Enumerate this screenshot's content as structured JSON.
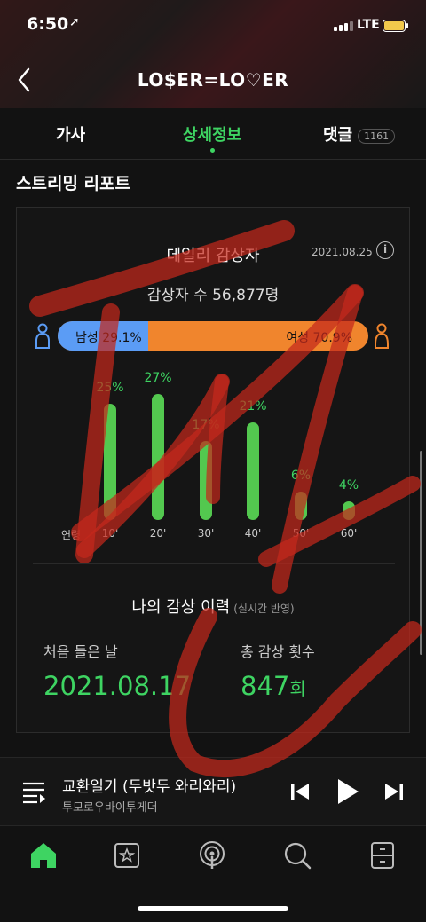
{
  "status_bar": {
    "time": "6:50",
    "network": "LTE"
  },
  "nav": {
    "title": "LO$ER=LO♡ER"
  },
  "tabs": [
    {
      "label": "가사"
    },
    {
      "label": "상세정보",
      "active": true
    },
    {
      "label": "댓글",
      "badge": "1161"
    }
  ],
  "section": {
    "title": "스트리밍 리포트"
  },
  "daily": {
    "title": "데일리 감상자",
    "date": "2021.08.25",
    "listeners": "감상자 수 56,877명",
    "gender": {
      "male_label": "남성 29.1%",
      "female_label": "여성 70.9%",
      "male_fraction": 0.291
    }
  },
  "age_chart": {
    "axis_label": "연령",
    "labels": [
      "10'",
      "20'",
      "30'",
      "40'",
      "50'",
      "60'"
    ],
    "percents": [
      "25%",
      "27%",
      "17%",
      "21%",
      "6%",
      "4%"
    ],
    "values": [
      25,
      27,
      17,
      21,
      6,
      4
    ]
  },
  "my_history": {
    "title": "나의 감상 이력",
    "subtitle": "(실시간 반영)",
    "first_label": "처음 들은 날",
    "first_value": "2021.08.17",
    "total_label": "총 감상 횟수",
    "total_value": "847",
    "total_unit": "회"
  },
  "player": {
    "title": "교환일기 (두밧두 와리와리)",
    "artist": "투모로우바이투게더"
  },
  "colors": {
    "accent_green": "#3ed462",
    "male_blue": "#5b9cf5",
    "female_orange": "#f0852d",
    "scribble_red": "#c4281c"
  },
  "icons": {
    "tabbar": [
      "home-icon",
      "library-icon",
      "podcast-icon",
      "search-icon",
      "storage-icon"
    ]
  }
}
